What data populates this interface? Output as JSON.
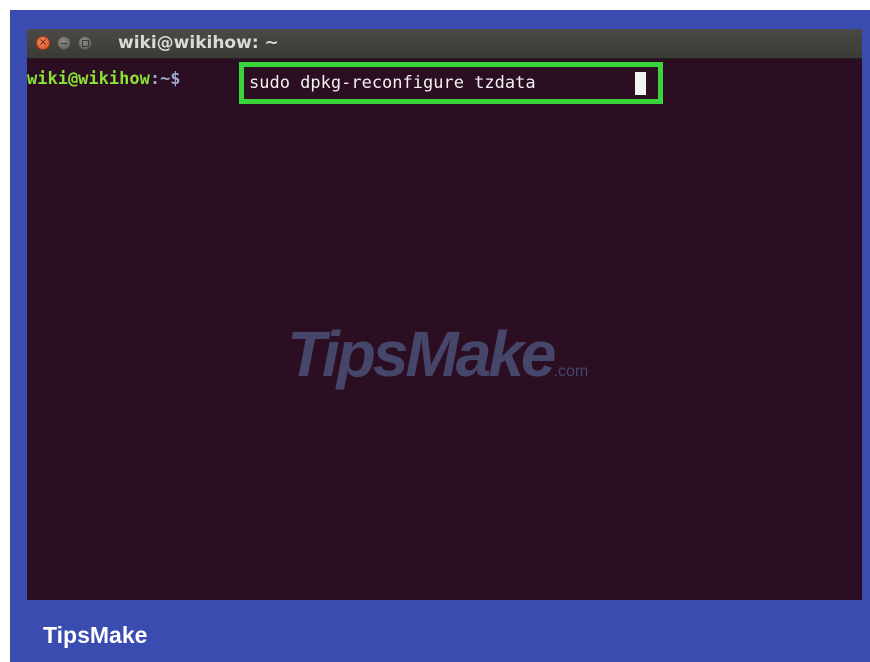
{
  "terminal": {
    "window_title": "wiki@wikihow: ~",
    "prompt_user_host": "wiki@wikihow",
    "prompt_path": ":~$",
    "command": "sudo dpkg-reconfigure tzdata"
  },
  "watermark": {
    "text": "TipsMake",
    "suffix": ".com"
  },
  "footer": {
    "brand": "TipsMake"
  },
  "colors": {
    "frame_background": "#3a4cb0",
    "terminal_background": "#2c0e22",
    "prompt_green": "#8ae234",
    "highlight_box": "#38d43a"
  },
  "icons": [
    "close-icon",
    "minimize-icon",
    "maximize-icon"
  ]
}
